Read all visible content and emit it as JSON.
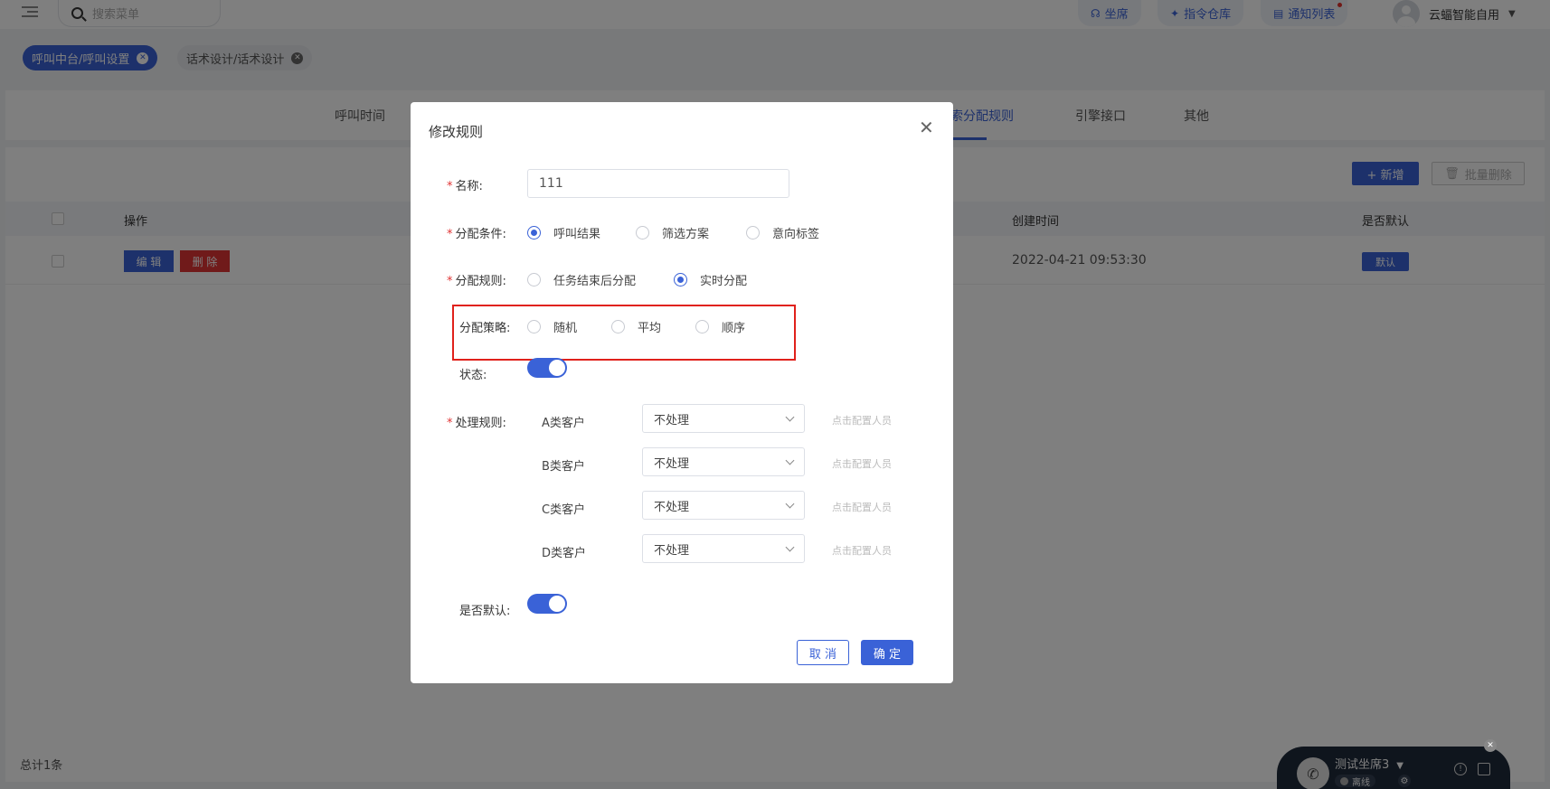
{
  "header": {
    "search_placeholder": "搜索菜单",
    "pills": [
      {
        "label": "坐席",
        "icon": "headset-icon"
      },
      {
        "label": "指令仓库",
        "icon": "pin-icon"
      },
      {
        "label": "通知列表",
        "icon": "notice-icon"
      }
    ],
    "user": "云蝠智能自用"
  },
  "tags": [
    {
      "label": "呼叫中台/呼叫设置",
      "active": true
    },
    {
      "label": "话术设计/话术设计",
      "active": false
    }
  ],
  "bg_tabs": [
    "呼叫时间",
    "索分配规则",
    "引擎接口",
    "其他"
  ],
  "toolbar": {
    "add_label": "+ 新增",
    "batch_delete_label": "批量删除"
  },
  "table": {
    "headers": {
      "action": "操作",
      "created": "创建时间",
      "is_default": "是否默认"
    },
    "rows": [
      {
        "edit": "编 辑",
        "delete": "删 除",
        "created": "2022-04-21 09:53:30",
        "default_badge": "默认"
      }
    ],
    "total": "总计1条"
  },
  "modal": {
    "title": "修改规则",
    "name_label": "名称:",
    "name_value": "111",
    "condition_label": "分配条件:",
    "condition_options": [
      "呼叫结果",
      "筛选方案",
      "意向标签"
    ],
    "condition_selected": "呼叫结果",
    "rule_label": "分配规则:",
    "rule_options": [
      "任务结束后分配",
      "实时分配"
    ],
    "rule_selected": "实时分配",
    "strategy_label": "分配策略:",
    "strategy_options": [
      "随机",
      "平均",
      "顺序"
    ],
    "status_label": "状态:",
    "status_on": true,
    "process_label": "处理规则:",
    "process_rows": [
      {
        "customer": "A类客户",
        "value": "不处理",
        "link": "点击配置人员"
      },
      {
        "customer": "B类客户",
        "value": "不处理",
        "link": "点击配置人员"
      },
      {
        "customer": "C类客户",
        "value": "不处理",
        "link": "点击配置人员"
      },
      {
        "customer": "D类客户",
        "value": "不处理",
        "link": "点击配置人员"
      }
    ],
    "default_label": "是否默认:",
    "default_on": true,
    "cancel_label": "取 消",
    "ok_label": "确 定"
  },
  "softphone": {
    "name": "测试坐席3",
    "status": "离线"
  },
  "colors": {
    "primary": "#3a62d7",
    "danger": "#e03434",
    "highlight": "#e0211b"
  }
}
